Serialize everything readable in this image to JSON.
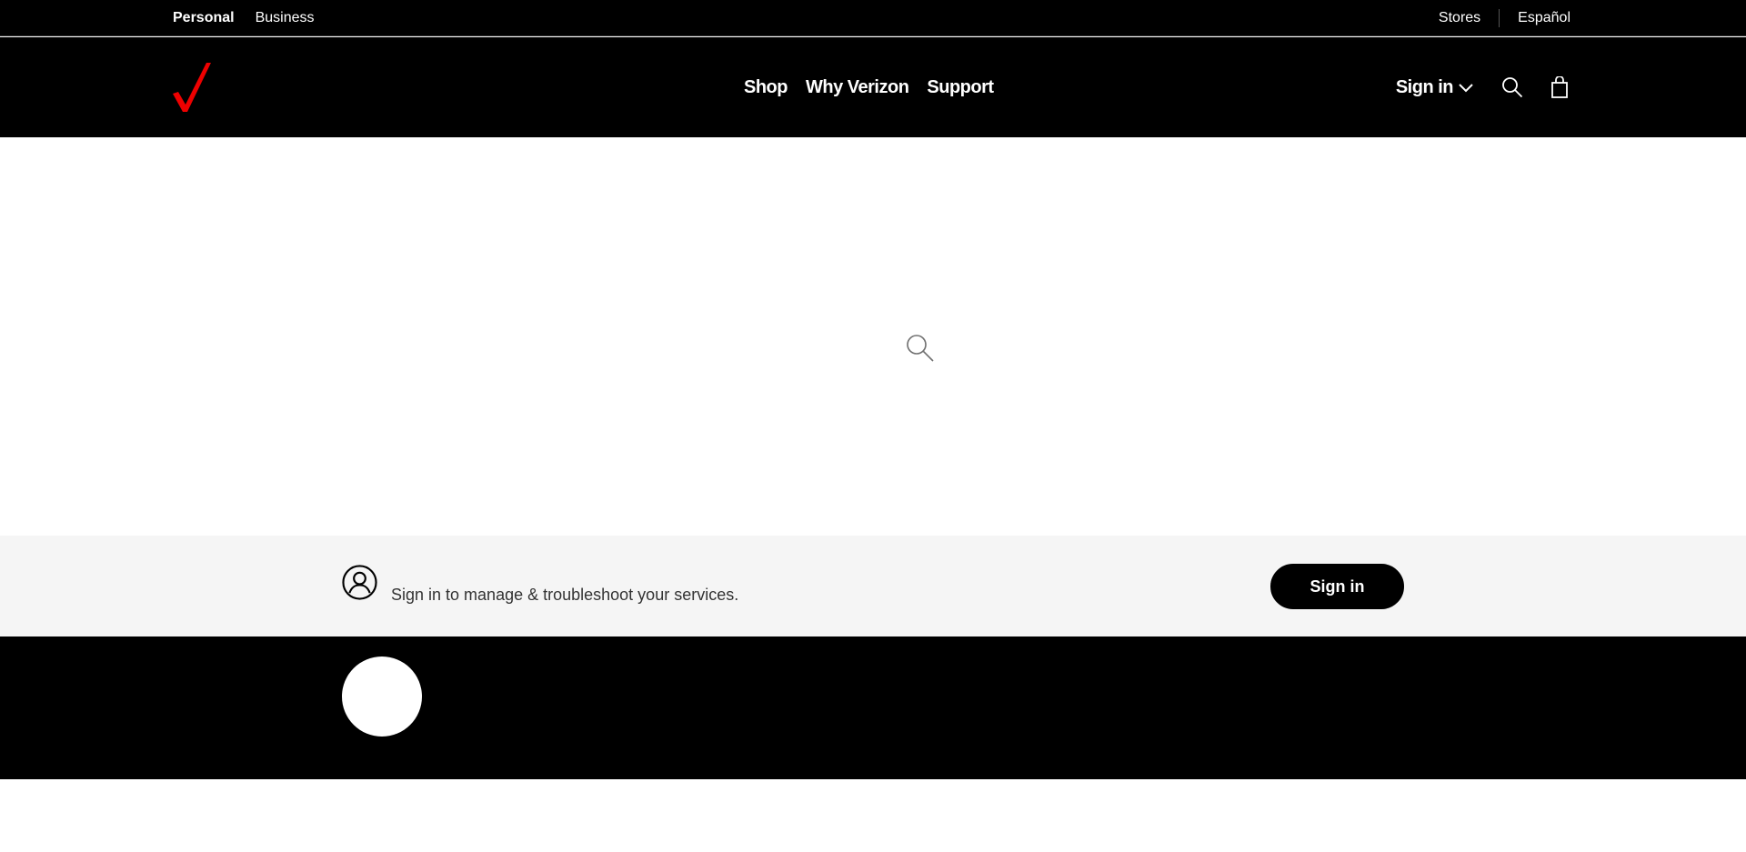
{
  "utility_bar": {
    "left_links": [
      {
        "label": "Personal",
        "active": true
      },
      {
        "label": "Business",
        "active": false
      }
    ],
    "right_links": [
      {
        "label": "Stores"
      },
      {
        "label": "Español"
      }
    ]
  },
  "header": {
    "logo_icon": "verizon-check-icon",
    "brand_color": "#ee0000",
    "nav": [
      {
        "label": "Shop"
      },
      {
        "label": "Why Verizon"
      },
      {
        "label": "Support"
      }
    ],
    "signin_label": "Sign in",
    "signin_icon": "chevron-down-icon",
    "search_icon": "search-icon",
    "cart_icon": "shopping-bag-icon"
  },
  "content": {
    "loading_icon": "search-icon"
  },
  "signin_banner": {
    "icon": "user-account-icon",
    "text": "Sign in to manage & troubleshoot your services.",
    "button_label": "Sign in"
  },
  "footer": {
    "badge_icon": "circle-icon"
  }
}
